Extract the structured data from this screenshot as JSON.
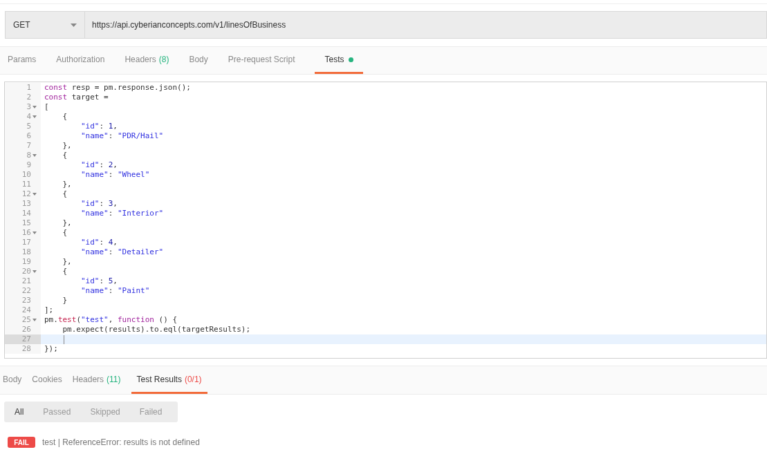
{
  "request": {
    "method": "GET",
    "url": "https://api.cyberianconcepts.com/v1/linesOfBusiness"
  },
  "request_tabs": [
    {
      "label": "Params",
      "selected": false
    },
    {
      "label": "Authorization",
      "selected": false
    },
    {
      "label": "Headers",
      "count": "(8)",
      "selected": false
    },
    {
      "label": "Body",
      "selected": false
    },
    {
      "label": "Pre-request Script",
      "selected": false
    },
    {
      "label": "Tests",
      "dot": true,
      "selected": true
    }
  ],
  "editor": {
    "lines": [
      {
        "number": "1",
        "foldable": false,
        "active": false,
        "tokens": [
          {
            "kind": "keyword",
            "text": "const"
          },
          {
            "kind": "plain",
            "text": " resp = pm.response.json();"
          }
        ]
      },
      {
        "number": "2",
        "foldable": false,
        "active": false,
        "tokens": [
          {
            "kind": "keyword",
            "text": "const"
          },
          {
            "kind": "plain",
            "text": " target ="
          }
        ]
      },
      {
        "number": "3",
        "foldable": true,
        "active": false,
        "tokens": [
          {
            "kind": "plain",
            "text": "["
          }
        ]
      },
      {
        "number": "4",
        "foldable": true,
        "active": false,
        "tokens": [
          {
            "kind": "plain",
            "text": "    {"
          }
        ]
      },
      {
        "number": "5",
        "foldable": false,
        "active": false,
        "tokens": [
          {
            "kind": "string",
            "text": "        \"id\""
          },
          {
            "kind": "plain",
            "text": ": "
          },
          {
            "kind": "number",
            "text": "1"
          },
          {
            "kind": "plain",
            "text": ","
          }
        ]
      },
      {
        "number": "6",
        "foldable": false,
        "active": false,
        "tokens": [
          {
            "kind": "string",
            "text": "        \"name\""
          },
          {
            "kind": "plain",
            "text": ": "
          },
          {
            "kind": "string",
            "text": "\"PDR/Hail\""
          }
        ]
      },
      {
        "number": "7",
        "foldable": false,
        "active": false,
        "tokens": [
          {
            "kind": "plain",
            "text": "    },"
          }
        ]
      },
      {
        "number": "8",
        "foldable": true,
        "active": false,
        "tokens": [
          {
            "kind": "plain",
            "text": "    {"
          }
        ]
      },
      {
        "number": "9",
        "foldable": false,
        "active": false,
        "tokens": [
          {
            "kind": "string",
            "text": "        \"id\""
          },
          {
            "kind": "plain",
            "text": ": "
          },
          {
            "kind": "number",
            "text": "2"
          },
          {
            "kind": "plain",
            "text": ","
          }
        ]
      },
      {
        "number": "10",
        "foldable": false,
        "active": false,
        "tokens": [
          {
            "kind": "string",
            "text": "        \"name\""
          },
          {
            "kind": "plain",
            "text": ": "
          },
          {
            "kind": "string",
            "text": "\"Wheel\""
          }
        ]
      },
      {
        "number": "11",
        "foldable": false,
        "active": false,
        "tokens": [
          {
            "kind": "plain",
            "text": "    },"
          }
        ]
      },
      {
        "number": "12",
        "foldable": true,
        "active": false,
        "tokens": [
          {
            "kind": "plain",
            "text": "    {"
          }
        ]
      },
      {
        "number": "13",
        "foldable": false,
        "active": false,
        "tokens": [
          {
            "kind": "string",
            "text": "        \"id\""
          },
          {
            "kind": "plain",
            "text": ": "
          },
          {
            "kind": "number",
            "text": "3"
          },
          {
            "kind": "plain",
            "text": ","
          }
        ]
      },
      {
        "number": "14",
        "foldable": false,
        "active": false,
        "tokens": [
          {
            "kind": "string",
            "text": "        \"name\""
          },
          {
            "kind": "plain",
            "text": ": "
          },
          {
            "kind": "string",
            "text": "\"Interior\""
          }
        ]
      },
      {
        "number": "15",
        "foldable": false,
        "active": false,
        "tokens": [
          {
            "kind": "plain",
            "text": "    },"
          }
        ]
      },
      {
        "number": "16",
        "foldable": true,
        "active": false,
        "tokens": [
          {
            "kind": "plain",
            "text": "    {"
          }
        ]
      },
      {
        "number": "17",
        "foldable": false,
        "active": false,
        "tokens": [
          {
            "kind": "string",
            "text": "        \"id\""
          },
          {
            "kind": "plain",
            "text": ": "
          },
          {
            "kind": "number",
            "text": "4"
          },
          {
            "kind": "plain",
            "text": ","
          }
        ]
      },
      {
        "number": "18",
        "foldable": false,
        "active": false,
        "tokens": [
          {
            "kind": "string",
            "text": "        \"name\""
          },
          {
            "kind": "plain",
            "text": ": "
          },
          {
            "kind": "string",
            "text": "\"Detailer\""
          }
        ]
      },
      {
        "number": "19",
        "foldable": false,
        "active": false,
        "tokens": [
          {
            "kind": "plain",
            "text": "    },"
          }
        ]
      },
      {
        "number": "20",
        "foldable": true,
        "active": false,
        "tokens": [
          {
            "kind": "plain",
            "text": "    {"
          }
        ]
      },
      {
        "number": "21",
        "foldable": false,
        "active": false,
        "tokens": [
          {
            "kind": "string",
            "text": "        \"id\""
          },
          {
            "kind": "plain",
            "text": ": "
          },
          {
            "kind": "number",
            "text": "5"
          },
          {
            "kind": "plain",
            "text": ","
          }
        ]
      },
      {
        "number": "22",
        "foldable": false,
        "active": false,
        "tokens": [
          {
            "kind": "string",
            "text": "        \"name\""
          },
          {
            "kind": "plain",
            "text": ": "
          },
          {
            "kind": "string",
            "text": "\"Paint\""
          }
        ]
      },
      {
        "number": "23",
        "foldable": false,
        "active": false,
        "tokens": [
          {
            "kind": "plain",
            "text": "    }"
          }
        ]
      },
      {
        "number": "24",
        "foldable": false,
        "active": false,
        "tokens": [
          {
            "kind": "plain",
            "text": "];"
          }
        ]
      },
      {
        "number": "25",
        "foldable": true,
        "active": false,
        "tokens": [
          {
            "kind": "plain",
            "text": "pm."
          },
          {
            "kind": "method",
            "text": "test"
          },
          {
            "kind": "plain",
            "text": "("
          },
          {
            "kind": "string",
            "text": "\"test\""
          },
          {
            "kind": "plain",
            "text": ", "
          },
          {
            "kind": "keyword",
            "text": "function"
          },
          {
            "kind": "plain",
            "text": " () {"
          }
        ]
      },
      {
        "number": "26",
        "foldable": false,
        "active": false,
        "tokens": [
          {
            "kind": "plain",
            "text": "    pm.expect(results).to.eql(targetResults);"
          }
        ]
      },
      {
        "number": "27",
        "foldable": false,
        "active": true
      },
      {
        "number": "28",
        "foldable": false,
        "active": false,
        "tokens": [
          {
            "kind": "plain",
            "text": "});"
          }
        ]
      }
    ]
  },
  "response_tabs": [
    {
      "label": "Body",
      "selected": false
    },
    {
      "label": "Cookies",
      "selected": false
    },
    {
      "label": "Headers",
      "count": "(11)",
      "color": "#26b47f",
      "selected": false
    },
    {
      "label": "Test Results",
      "count": "(0/1)",
      "color": "#ed4b48",
      "selected": true
    }
  ],
  "filters": [
    {
      "label": "All",
      "selected": true
    },
    {
      "label": "Passed",
      "selected": false
    },
    {
      "label": "Skipped",
      "selected": false
    },
    {
      "label": "Failed",
      "selected": false
    }
  ],
  "results": [
    {
      "status": "FAIL",
      "kind": "fail",
      "message": "test | ReferenceError: results is not defined"
    }
  ]
}
